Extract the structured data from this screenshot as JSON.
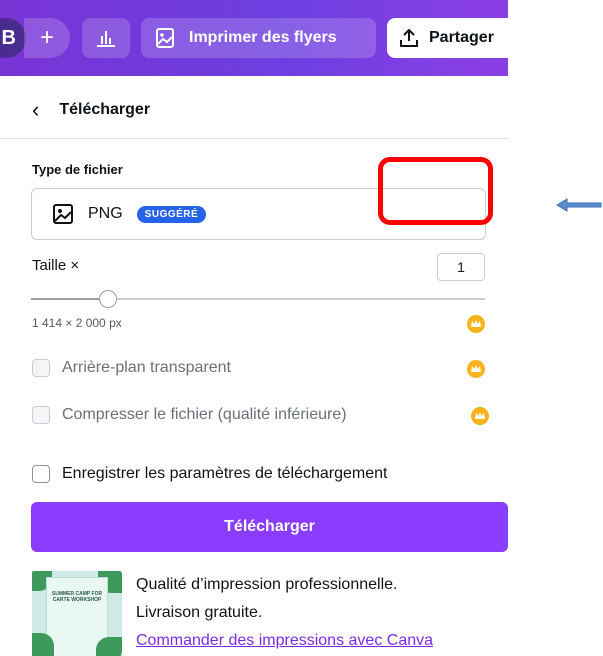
{
  "topbar": {
    "avatar_initial": "B",
    "plus_label": "+",
    "print_button_label": "Imprimer des flyers",
    "share_button_label": "Partager"
  },
  "panel": {
    "back_title": "Télécharger",
    "file_type_label": "Type de fichier",
    "file_type_value": "PNG",
    "file_type_badge": "SUGGÉRÉ",
    "size_label": "Taille ×",
    "size_value": "1",
    "size_slider_fraction": 0.17,
    "dimensions": "1 414 × 2 000 px",
    "options": [
      {
        "label": "Arrière-plan transparent",
        "premium": true,
        "enabled": false
      },
      {
        "label": "Compresser le fichier (qualité inférieure)",
        "premium": true,
        "enabled": false
      },
      {
        "label": "Enregistrer les paramètres de téléchargement",
        "premium": false,
        "enabled": true
      }
    ],
    "download_button_label": "Télécharger"
  },
  "promo": {
    "thumbnail_title": "SUMMER CAMP FOR CARTE WORKSHOP",
    "line1": "Qualité d’impression professionnelle.",
    "line2": "Livraison gratuite.",
    "link": "Commander des impressions avec Canva"
  },
  "colors": {
    "topbar_gradient": [
      "#7a33d6",
      "#8b3fe6"
    ],
    "accent": "#8b3dff",
    "badge": "#2563eb",
    "crown": "#f8b31d",
    "highlight": "#ff0000",
    "annotation_arrow": "#5b8fd0"
  },
  "annotations": {
    "highlight_box": "red-rounded-rectangle",
    "arrow": "left-pointing-arrow"
  }
}
